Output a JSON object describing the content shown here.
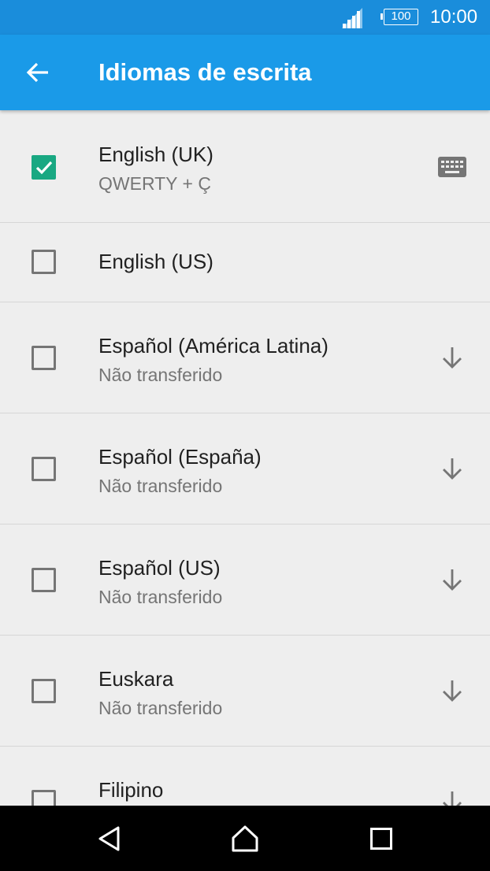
{
  "status_bar": {
    "battery": "100",
    "time": "10:00",
    "icons": [
      "signal-icon",
      "battery-icon"
    ]
  },
  "app_bar": {
    "title": "Idiomas de escrita",
    "back_icon": "arrow-back-icon"
  },
  "languages": [
    {
      "name": "English (UK)",
      "subtitle": "QWERTY + Ç",
      "checked": true,
      "action": "keyboard-icon"
    },
    {
      "name": "English (US)",
      "subtitle": "",
      "checked": false,
      "action": ""
    },
    {
      "name": "Español (América Latina)",
      "subtitle": "Não transferido",
      "checked": false,
      "action": "download-icon"
    },
    {
      "name": "Español (España)",
      "subtitle": "Não transferido",
      "checked": false,
      "action": "download-icon"
    },
    {
      "name": "Español (US)",
      "subtitle": "Não transferido",
      "checked": false,
      "action": "download-icon"
    },
    {
      "name": "Euskara",
      "subtitle": "Não transferido",
      "checked": false,
      "action": "download-icon"
    },
    {
      "name": "Filipino",
      "subtitle": "",
      "checked": false,
      "action": "download-icon"
    }
  ],
  "nav_bar": {
    "icons": [
      "back-triangle-icon",
      "home-icon",
      "recents-icon"
    ]
  },
  "colors": {
    "status_bar": "#1a8ddb",
    "app_bar": "#1a9ae8",
    "checkbox_checked": "#19a882",
    "background": "#eeeeee"
  }
}
